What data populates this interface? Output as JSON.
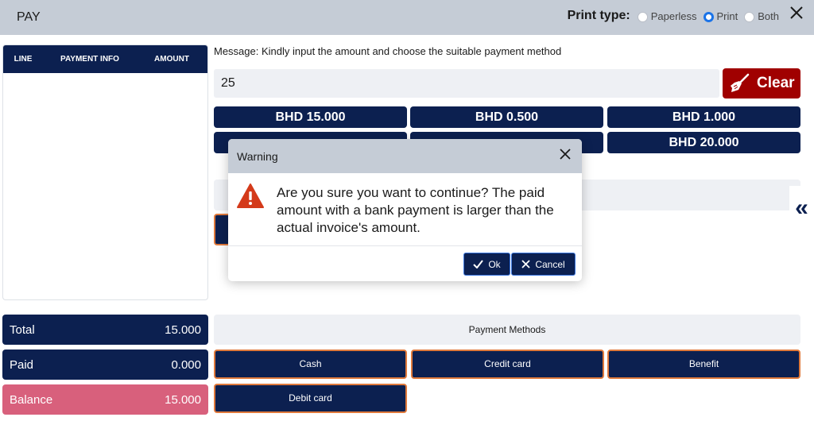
{
  "header": {
    "title": "PAY",
    "print_type_label": "Print type:",
    "print_options": [
      {
        "label": "Paperless",
        "selected": false
      },
      {
        "label": "Print",
        "selected": true
      },
      {
        "label": "Both",
        "selected": false
      }
    ],
    "close_icon": "close-icon"
  },
  "lines_table": {
    "columns": [
      "LINE",
      "PAYMENT INFO",
      "AMOUNT"
    ],
    "rows": []
  },
  "totals": {
    "total_label": "Total",
    "total_value": "15.000",
    "paid_label": "Paid",
    "paid_value": "0.000",
    "balance_label": "Balance",
    "balance_value": "15.000"
  },
  "message": "Message: Kindly input the amount and choose the suitable payment method",
  "amount_input": {
    "value": "25"
  },
  "clear_button": {
    "label": "Clear",
    "icon": "broom-icon"
  },
  "quick_amounts": [
    "BHD 15.000",
    "BHD 0.500",
    "BHD 1.000",
    "BHD 20.000"
  ],
  "payment_methods": {
    "header": "Payment Methods",
    "buttons": [
      "Cash",
      "Credit card",
      "Benefit",
      "Debit card"
    ]
  },
  "dialog": {
    "title": "Warning",
    "message": "Are you sure you want to continue? The paid amount with a bank payment is larger than the actual invoice's amount.",
    "ok_label": "Ok",
    "cancel_label": "Cancel",
    "icon": "warning-icon"
  },
  "side_toggle": "«",
  "colors": {
    "navy": "#0c2050",
    "header_gray": "#c5ccd6",
    "clear_red": "#a00000",
    "balance_pink": "#d8607c",
    "accent_orange": "#e07a3c",
    "warning_red": "#d43a1a"
  }
}
